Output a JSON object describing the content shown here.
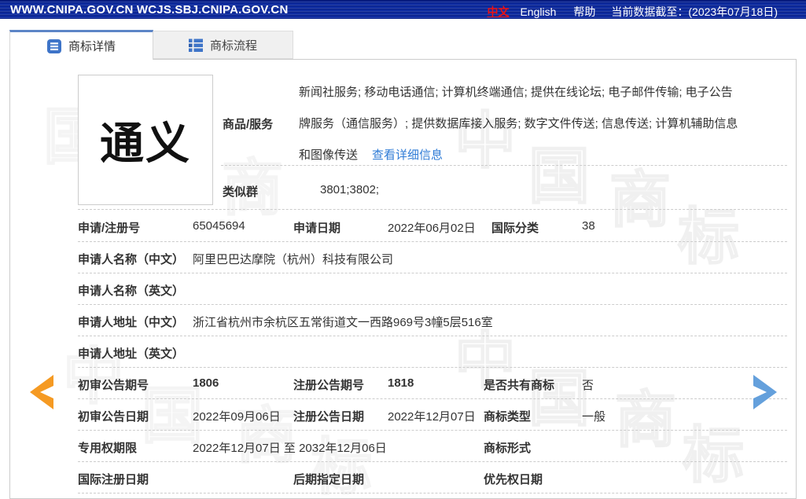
{
  "topbar": {
    "site_urls": "WWW.CNIPA.GOV.CN WCJS.SBJ.CNIPA.GOV.CN",
    "lang_zh": "中文",
    "lang_en": "English",
    "help": "帮助",
    "data_until": "当前数据截至：(2023年07月18日)"
  },
  "tabs": [
    {
      "label": "商标详情"
    },
    {
      "label": "商标流程"
    }
  ],
  "trademark": {
    "image_text": "通义"
  },
  "goods": {
    "label": "商品/服务",
    "lines": [
      "新闻社服务; 移动电话通信; 计算机终端通信; 提供在线论坛; 电子邮件传输; 电子公告",
      "牌服务（通信服务）; 提供数据库接入服务; 数字文件传送; 信息传送; 计算机辅助信息",
      "和图像传送"
    ],
    "detail_link": "查看详细信息"
  },
  "fields": {
    "similar_group": {
      "label": "类似群",
      "value": "3801;3802;"
    },
    "app_no": {
      "label": "申请/注册号",
      "value": "65045694"
    },
    "app_date": {
      "label": "申请日期",
      "value": "2022年06月02日"
    },
    "intl_class": {
      "label": "国际分类",
      "value": "38"
    },
    "applicant_cn": {
      "label": "申请人名称（中文）",
      "value": "阿里巴巴达摩院（杭州）科技有限公司"
    },
    "applicant_en": {
      "label": "申请人名称（英文）",
      "value": ""
    },
    "address_cn": {
      "label": "申请人地址（中文）",
      "value": "浙江省杭州市余杭区五常街道文一西路969号3幢5层516室"
    },
    "address_en": {
      "label": "申请人地址（英文）",
      "value": ""
    },
    "prelim_no": {
      "label": "初审公告期号",
      "value": "1806"
    },
    "reg_no": {
      "label": "注册公告期号",
      "value": "1818"
    },
    "shared": {
      "label": "是否共有商标",
      "value": "否"
    },
    "prelim_date": {
      "label": "初审公告日期",
      "value": "2022年09月06日"
    },
    "reg_date": {
      "label": "注册公告日期",
      "value": "2022年12月07日"
    },
    "tm_type": {
      "label": "商标类型",
      "value": "一般"
    },
    "exclusive_period": {
      "label": "专用权期限",
      "value": "2022年12月07日 至 2032年12月06日"
    },
    "tm_form": {
      "label": "商标形式",
      "value": ""
    },
    "intl_reg_date": {
      "label": "国际注册日期",
      "value": ""
    },
    "later_date": {
      "label": "后期指定日期",
      "value": ""
    },
    "priority_date": {
      "label": "优先权日期",
      "value": ""
    }
  },
  "watermark": {
    "chars": [
      "中",
      "国",
      "商",
      "标"
    ]
  },
  "colors": {
    "topbar_blue": "#0D2A9F",
    "tab_accent_blue": "#5C85C7",
    "icon_blue": "#3E74C8",
    "link_blue": "#2E7BD6",
    "lang_red": "#EE1111",
    "arrow_orange": "#F59A23",
    "arrow_blue": "#64A0DC"
  }
}
